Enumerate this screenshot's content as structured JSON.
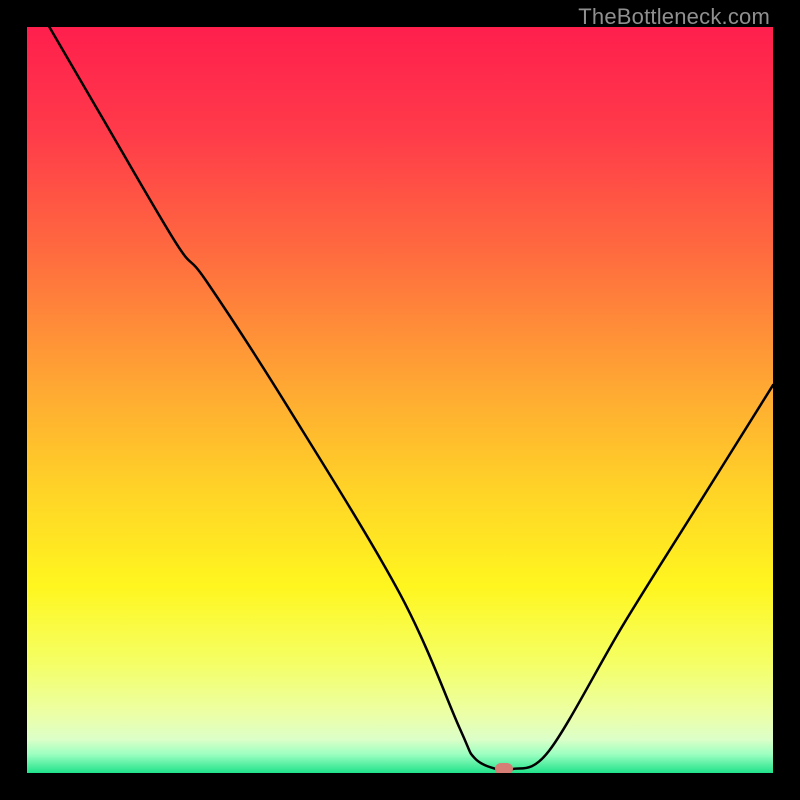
{
  "watermark": "TheBottleneck.com",
  "colors": {
    "frame": "#000000",
    "gradient_stops": [
      {
        "pos": 0.0,
        "color": "#ff1f4d"
      },
      {
        "pos": 0.14,
        "color": "#ff3a4a"
      },
      {
        "pos": 0.3,
        "color": "#ff6a3f"
      },
      {
        "pos": 0.48,
        "color": "#ffa733"
      },
      {
        "pos": 0.62,
        "color": "#ffd327"
      },
      {
        "pos": 0.75,
        "color": "#fff61f"
      },
      {
        "pos": 0.85,
        "color": "#f5ff63"
      },
      {
        "pos": 0.92,
        "color": "#ecffa5"
      },
      {
        "pos": 0.955,
        "color": "#dcffc8"
      },
      {
        "pos": 0.975,
        "color": "#9cffc1"
      },
      {
        "pos": 1.0,
        "color": "#20e28a"
      }
    ],
    "curve": "#000000",
    "marker": "#d67d76"
  },
  "chart_data": {
    "type": "line",
    "title": "",
    "xlabel": "",
    "ylabel": "",
    "xlim": [
      0,
      100
    ],
    "ylim": [
      0,
      100
    ],
    "series": [
      {
        "name": "bottleneck-curve",
        "x": [
          3,
          10,
          20,
          24,
          35,
          50,
          58,
          60,
          63,
          65,
          70,
          80,
          90,
          100
        ],
        "y": [
          100,
          88,
          71,
          66,
          49,
          24,
          6,
          2,
          0.5,
          0.5,
          3,
          20,
          36,
          52
        ]
      }
    ],
    "marker": {
      "x": 64,
      "y": 0.5
    }
  }
}
